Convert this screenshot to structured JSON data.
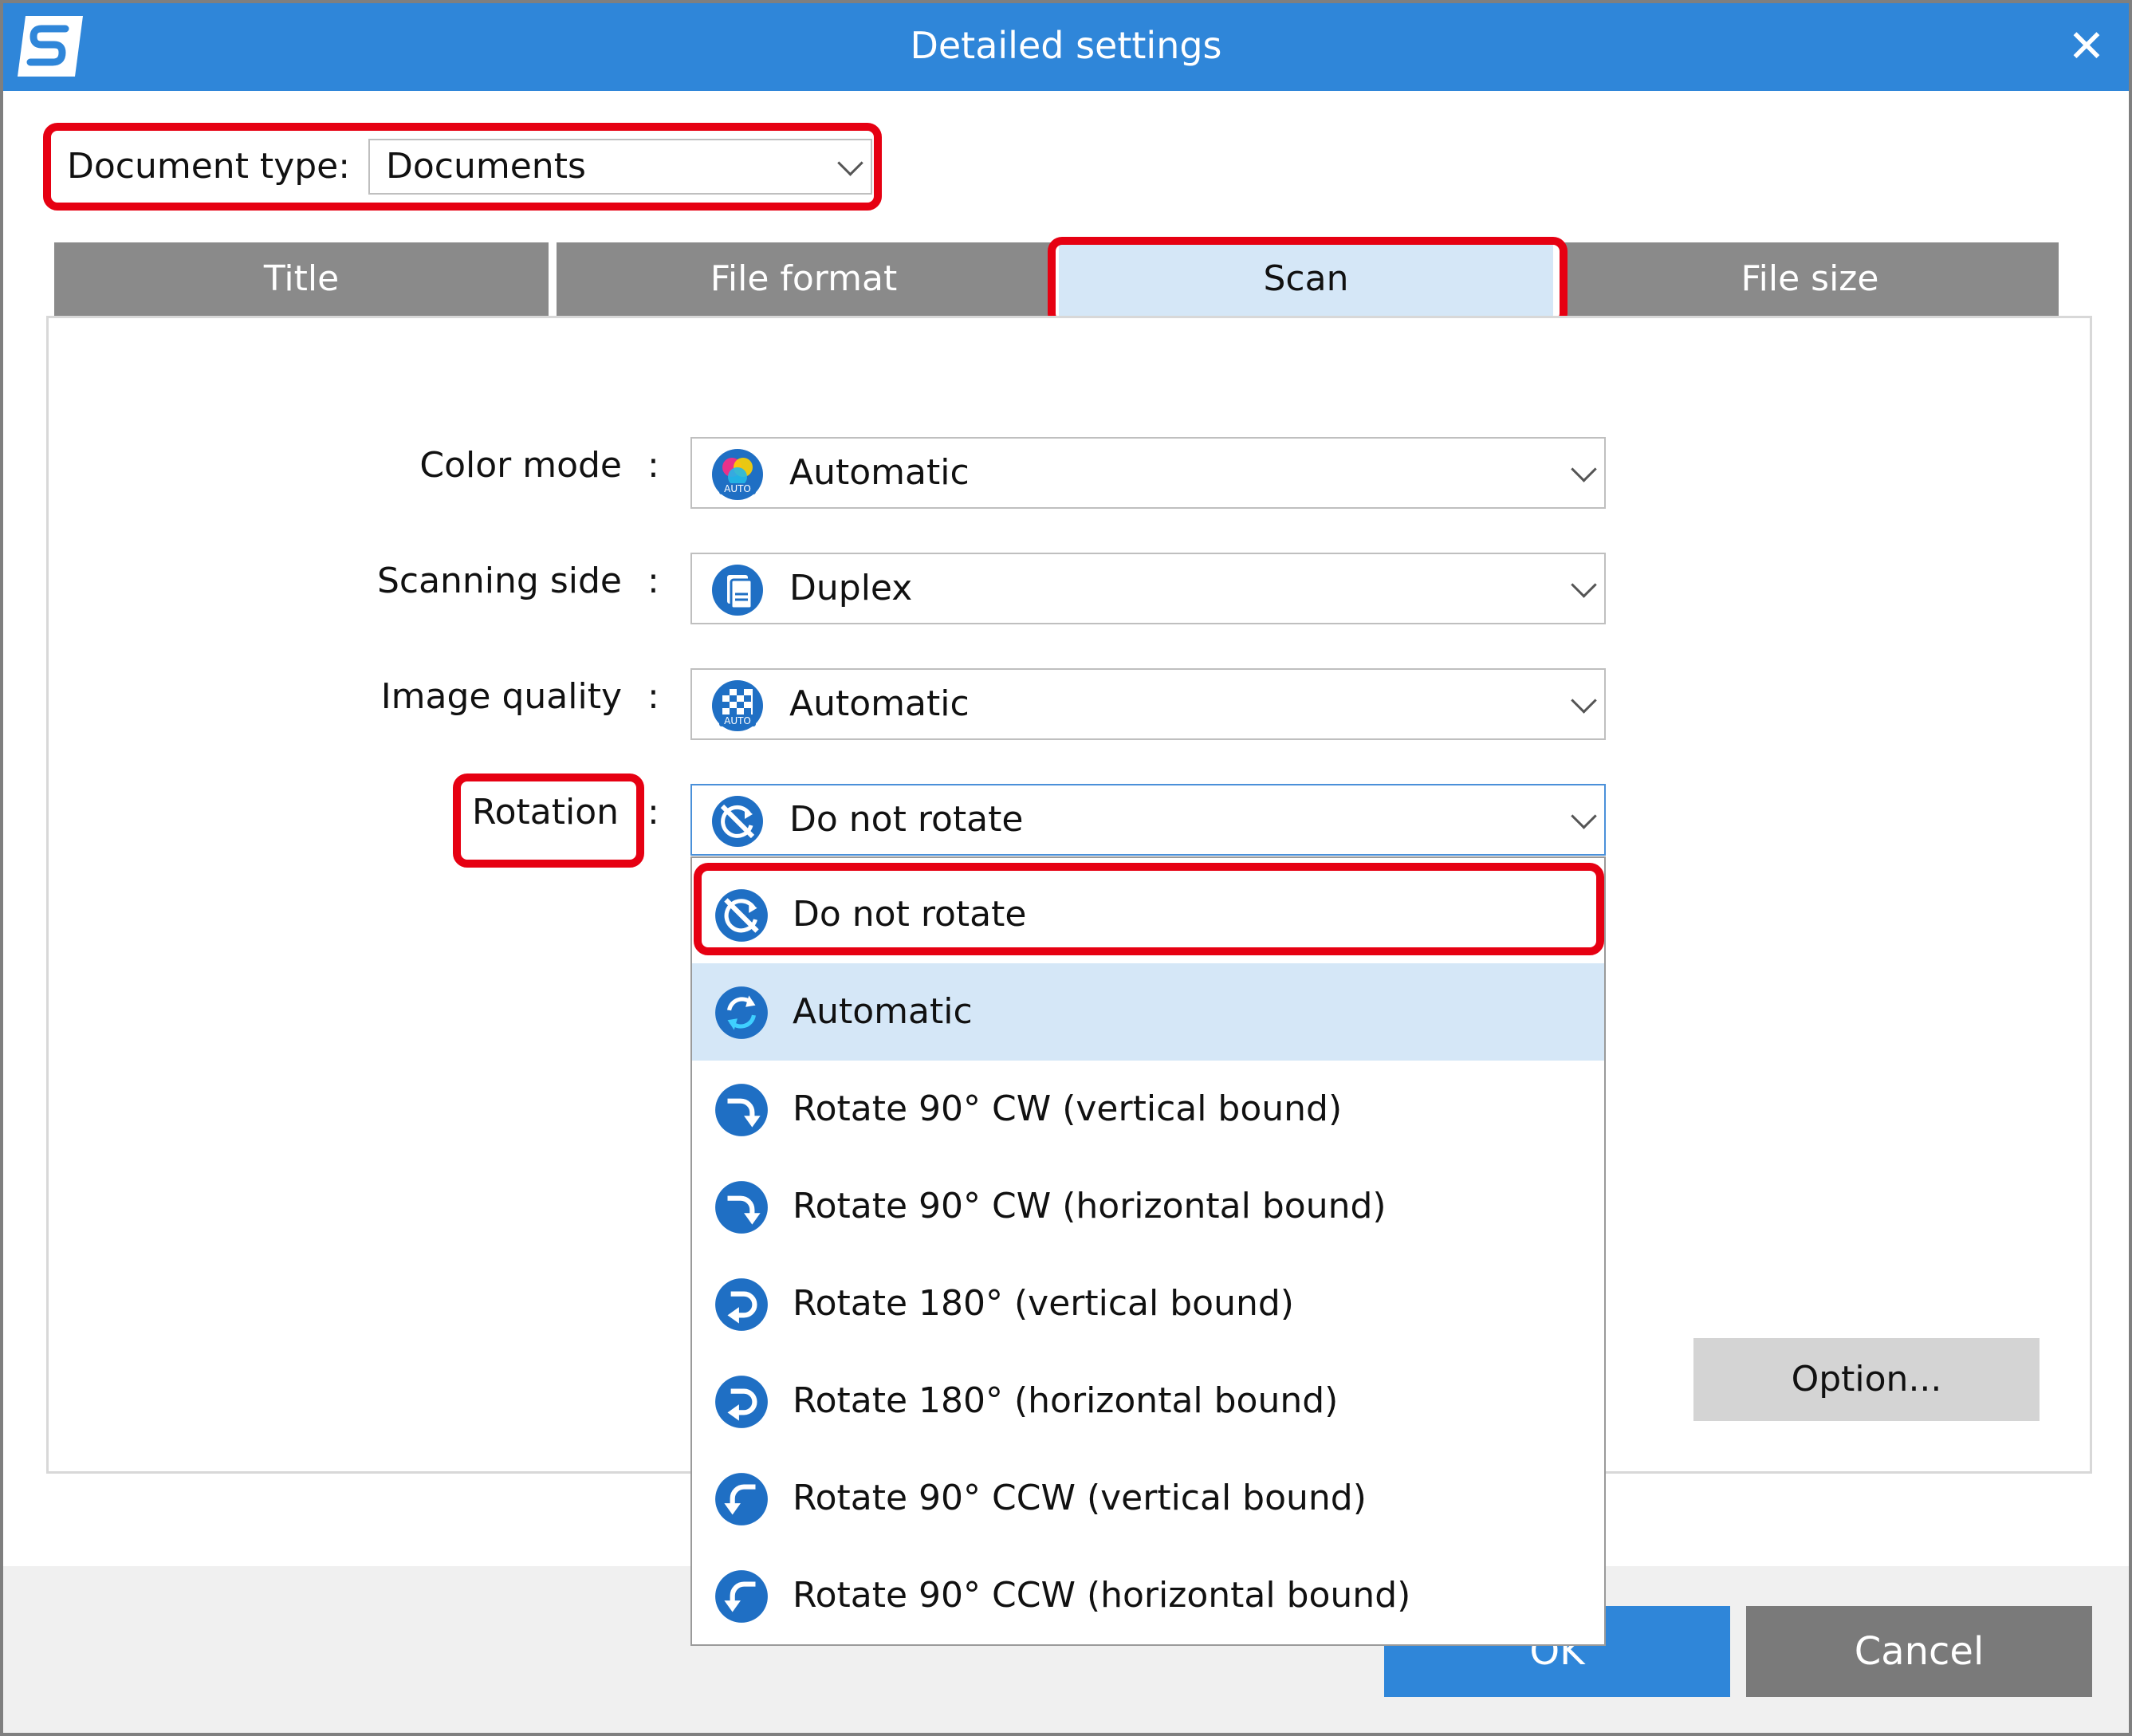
{
  "window": {
    "title": "Detailed settings",
    "close_glyph": "✕"
  },
  "document_type": {
    "label": "Document type:",
    "value": "Documents"
  },
  "tabs": [
    {
      "label": "Title"
    },
    {
      "label": "File format"
    },
    {
      "label": "Scan"
    },
    {
      "label": "File size"
    }
  ],
  "settings": {
    "color_mode": {
      "label": "Color mode",
      "value": "Automatic",
      "icon": "color-auto-icon"
    },
    "scanning_side": {
      "label": "Scanning side",
      "value": "Duplex",
      "icon": "duplex-icon"
    },
    "image_quality": {
      "label": "Image quality",
      "value": "Automatic",
      "icon": "quality-auto-icon"
    },
    "rotation": {
      "label": "Rotation",
      "value": "Do not rotate",
      "icon": "no-rotate-icon"
    },
    "colon": ":"
  },
  "rotation_options": [
    {
      "label": "Do not rotate",
      "icon": "no-rotate-icon"
    },
    {
      "label": "Automatic",
      "icon": "auto-rotate-icon"
    },
    {
      "label": "Rotate 90° CW (vertical bound)",
      "icon": "rotate-cw-icon"
    },
    {
      "label": "Rotate 90° CW (horizontal bound)",
      "icon": "rotate-cw-icon"
    },
    {
      "label": "Rotate 180° (vertical bound)",
      "icon": "rotate-180-icon"
    },
    {
      "label": "Rotate 180° (horizontal bound)",
      "icon": "rotate-180-icon"
    },
    {
      "label": "Rotate 90° CCW (vertical bound)",
      "icon": "rotate-ccw-icon"
    },
    {
      "label": "Rotate 90° CCW (horizontal bound)",
      "icon": "rotate-ccw-icon"
    }
  ],
  "buttons": {
    "option": "Option...",
    "ok": "OK",
    "cancel": "Cancel"
  },
  "colors": {
    "accent": "#2f86d9",
    "highlight": "#e60012",
    "tab_inactive": "#8a8a8a",
    "tab_active": "#d5e7f7"
  }
}
